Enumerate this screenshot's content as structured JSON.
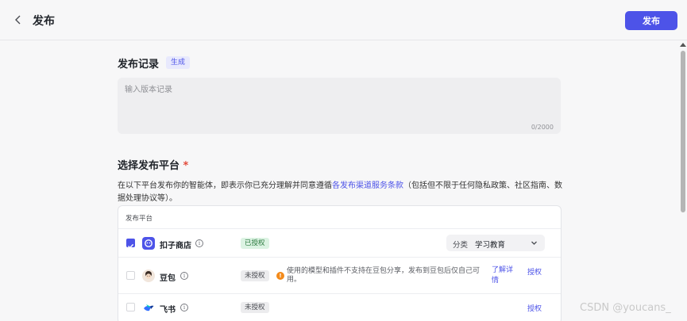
{
  "header": {
    "title": "发布",
    "publish_label": "发布"
  },
  "record": {
    "title": "发布记录",
    "generate_label": "生成",
    "placeholder": "输入版本记录",
    "value": "",
    "counter": "0/2000"
  },
  "platforms": {
    "title": "选择发布平台",
    "required_mark": "*",
    "desc_prefix": "在以下平台发布你的智能体，即表示你已充分理解并同意遵循",
    "desc_link": "各发布渠道服务条款",
    "desc_suffix": "（包括但不限于任何隐私政策、社区指南、数据处理协议等）。",
    "column_header": "发布平台",
    "rows": [
      {
        "name": "扣子商店",
        "checked": true,
        "status": "已授权",
        "category_label": "分类",
        "category_value": "学习教育"
      },
      {
        "name": "豆包",
        "checked": false,
        "status": "未授权",
        "warning": "使用的模型和插件不支持在豆包分享，发布到豆包后仅自己可用。",
        "learn_more": "了解详情",
        "action": "授权"
      },
      {
        "name": "飞书",
        "checked": false,
        "status": "未授权",
        "action": "授权"
      }
    ]
  },
  "watermark": "CSDN @youcans_",
  "colors": {
    "accent": "#4d53e8",
    "authorized": "#2b7a3f",
    "warning": "#f38a1a",
    "required": "#e24a3b"
  },
  "icons": {
    "back": "chevron-left-icon",
    "info": "info-icon",
    "warning": "warning-icon",
    "dropdown": "chevron-down-icon",
    "check": "check-icon"
  }
}
